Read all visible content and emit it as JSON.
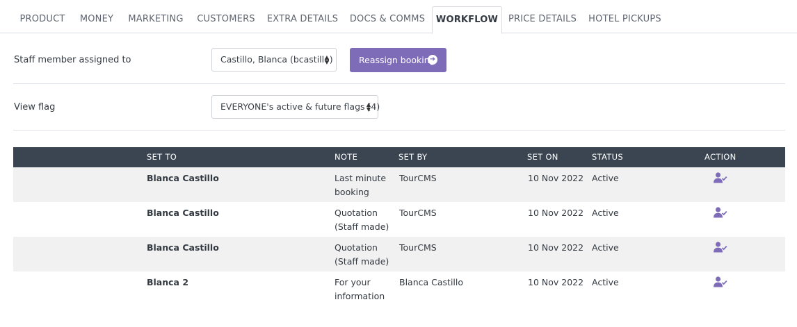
{
  "tabs": [
    {
      "label": "PRODUCT",
      "active": false
    },
    {
      "label": "MONEY",
      "active": false
    },
    {
      "label": "MARKETING",
      "active": false
    },
    {
      "label": "CUSTOMERS",
      "active": false
    },
    {
      "label": "EXTRA DETAILS",
      "active": false
    },
    {
      "label": "DOCS & COMMS",
      "active": false
    },
    {
      "label": "WORKFLOW",
      "active": true
    },
    {
      "label": "PRICE DETAILS",
      "active": false
    },
    {
      "label": "HOTEL PICKUPS",
      "active": false
    }
  ],
  "staff": {
    "label": "Staff member assigned to",
    "selected": "Castillo, Blanca (bcastillo)",
    "reassign_label": "Reassign booking"
  },
  "flag": {
    "label": "View flag",
    "selected": "EVERYONE's active & future flags (4)"
  },
  "table": {
    "headers": {
      "set_to": "SET TO",
      "note": "NOTE",
      "set_by": "SET BY",
      "set_on": "SET ON",
      "status": "STATUS",
      "action": "ACTION"
    },
    "rows": [
      {
        "set_to": "Blanca Castillo",
        "note": "Last minute booking",
        "set_by": "TourCMS",
        "set_on": "10 Nov 2022",
        "status": "Active"
      },
      {
        "set_to": "Blanca Castillo",
        "note": "Quotation (Staff made)",
        "set_by": "TourCMS",
        "set_on": "10 Nov 2022",
        "status": "Active"
      },
      {
        "set_to": "Blanca Castillo",
        "note": "Quotation (Staff made)",
        "set_by": "TourCMS",
        "set_on": "10 Nov 2022",
        "status": "Active"
      },
      {
        "set_to": "Blanca 2",
        "note": "For your information",
        "set_by": "Blanca Castillo",
        "set_on": "10 Nov 2022",
        "status": "Active"
      }
    ]
  },
  "colors": {
    "accent": "#7e6cb9",
    "header_bg": "#3a4551",
    "row_alt": "#f1f1f1"
  },
  "icons": {
    "reassign": "arrow-circle-right-icon",
    "action": "user-check-icon",
    "select_caret": "sort-caret-icon"
  }
}
